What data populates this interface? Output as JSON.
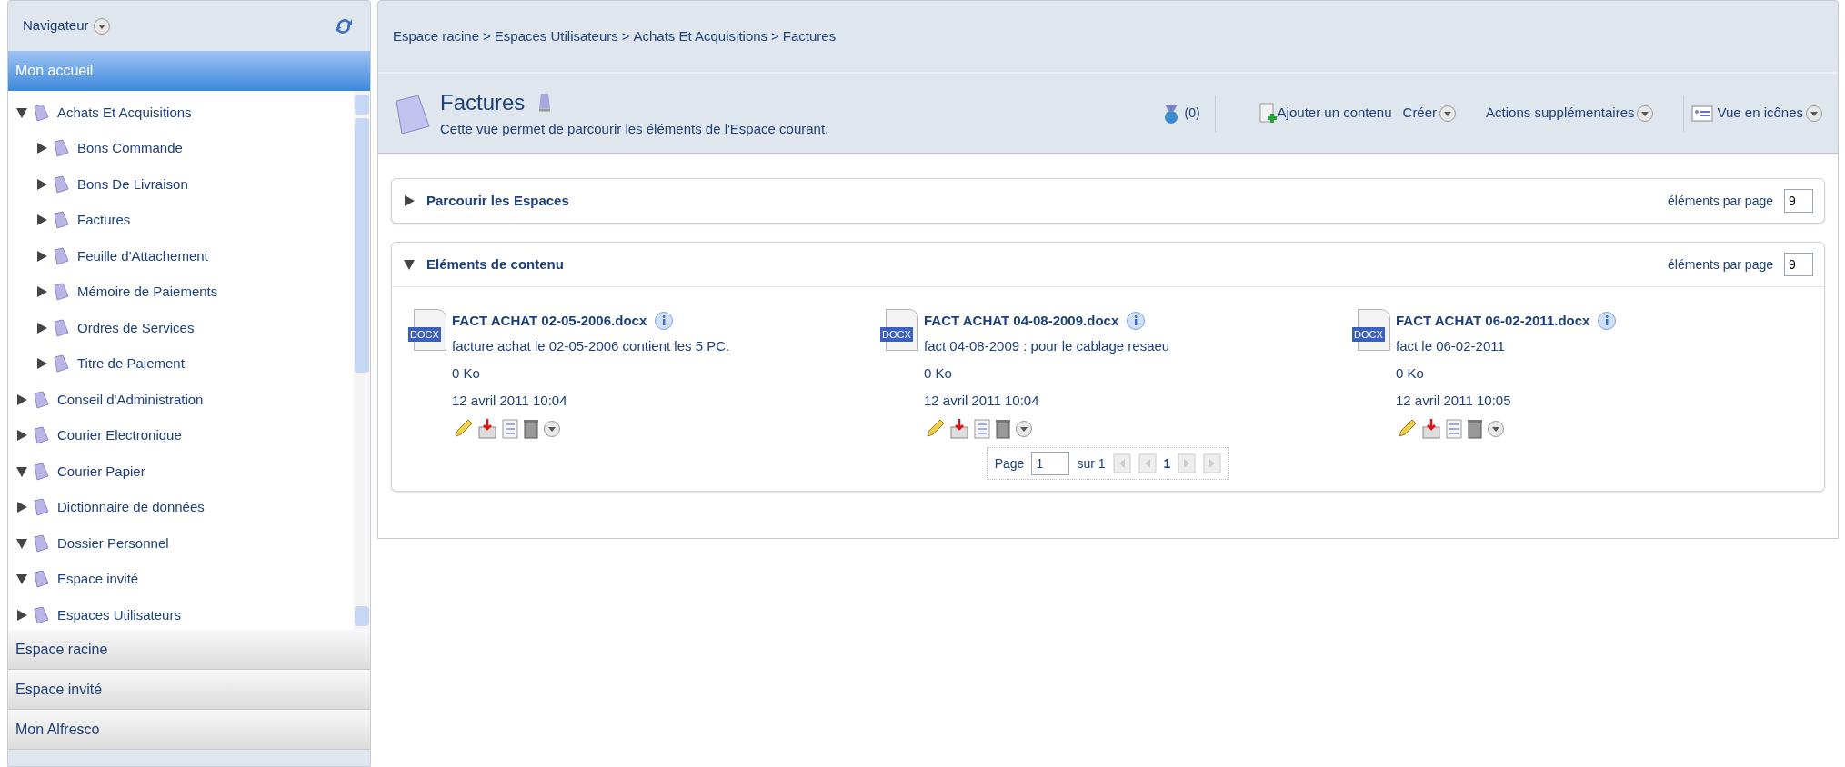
{
  "navigator": {
    "title": "Navigateur",
    "sections": [
      {
        "label": "Mon accueil",
        "selected": true
      },
      {
        "label": "Espace racine",
        "selected": false
      },
      {
        "label": "Espace invité",
        "selected": false
      },
      {
        "label": "Mon Alfresco",
        "selected": false
      }
    ],
    "tree": [
      {
        "label": "Achats Et Acquisitions",
        "expanded": true,
        "children": [
          {
            "label": "Bons Commande",
            "expanded": false
          },
          {
            "label": "Bons De Livraison",
            "expanded": false
          },
          {
            "label": "Factures",
            "expanded": false
          },
          {
            "label": "Feuille d'Attachement",
            "expanded": false
          },
          {
            "label": "Mémoire de Paiements",
            "expanded": false
          },
          {
            "label": "Ordres de Services",
            "expanded": false
          },
          {
            "label": "Titre de Paiement",
            "expanded": false
          }
        ]
      },
      {
        "label": "Conseil d'Administration",
        "expanded": false
      },
      {
        "label": "Courier Electronique",
        "expanded": false
      },
      {
        "label": "Courier Papier",
        "expanded": true
      },
      {
        "label": "Dictionnaire de données",
        "expanded": false
      },
      {
        "label": "Dossier Personnel",
        "expanded": true
      },
      {
        "label": "Espace invité",
        "expanded": true
      },
      {
        "label": "Espaces Utilisateurs",
        "expanded": false
      }
    ]
  },
  "breadcrumb": {
    "separator": ">",
    "items": [
      "Espace racine",
      "Espaces Utilisateurs",
      "Achats Et Acquisitions",
      "Factures"
    ]
  },
  "space": {
    "title": "Factures",
    "description": "Cette vue permet de parcourir les éléments de l'Espace courant.",
    "rules_count": "(0)",
    "actions": [
      {
        "kind": "add",
        "label": "Ajouter un contenu"
      },
      {
        "kind": "menu",
        "label": "Créer"
      },
      {
        "kind": "menu",
        "label": "Actions supplémentaires"
      },
      {
        "kind": "view",
        "label": "Vue en icônes"
      }
    ]
  },
  "panels": [
    {
      "title": "Parcourir les Espaces",
      "expanded": false,
      "per_page_label": "éléments par page",
      "per_page": "9"
    },
    {
      "title": "Eléments de contenu",
      "expanded": true,
      "per_page_label": "éléments par page",
      "per_page": "9"
    }
  ],
  "items": [
    {
      "name": "FACT ACHAT 02-05-2006.docx",
      "description": "facture achat le 02-05-2006 contient les 5 PC.",
      "size": "0 Ko",
      "date": "12 avril 2011 10:04",
      "badge": "DOCX"
    },
    {
      "name": "FACT ACHAT 04-08-2009.docx",
      "description": "fact 04-08-2009 : pour le cablage resaeu",
      "size": "0 Ko",
      "date": "12 avril 2011 10:04",
      "badge": "DOCX"
    },
    {
      "name": "FACT ACHAT 06-02-2011.docx",
      "description": "fact le 06-02-2011",
      "size": "0 Ko",
      "date": "12 avril 2011 10:05",
      "badge": "DOCX"
    }
  ],
  "pagination": {
    "label": "Page",
    "value": "1",
    "total": "sur 1",
    "current": "1"
  }
}
